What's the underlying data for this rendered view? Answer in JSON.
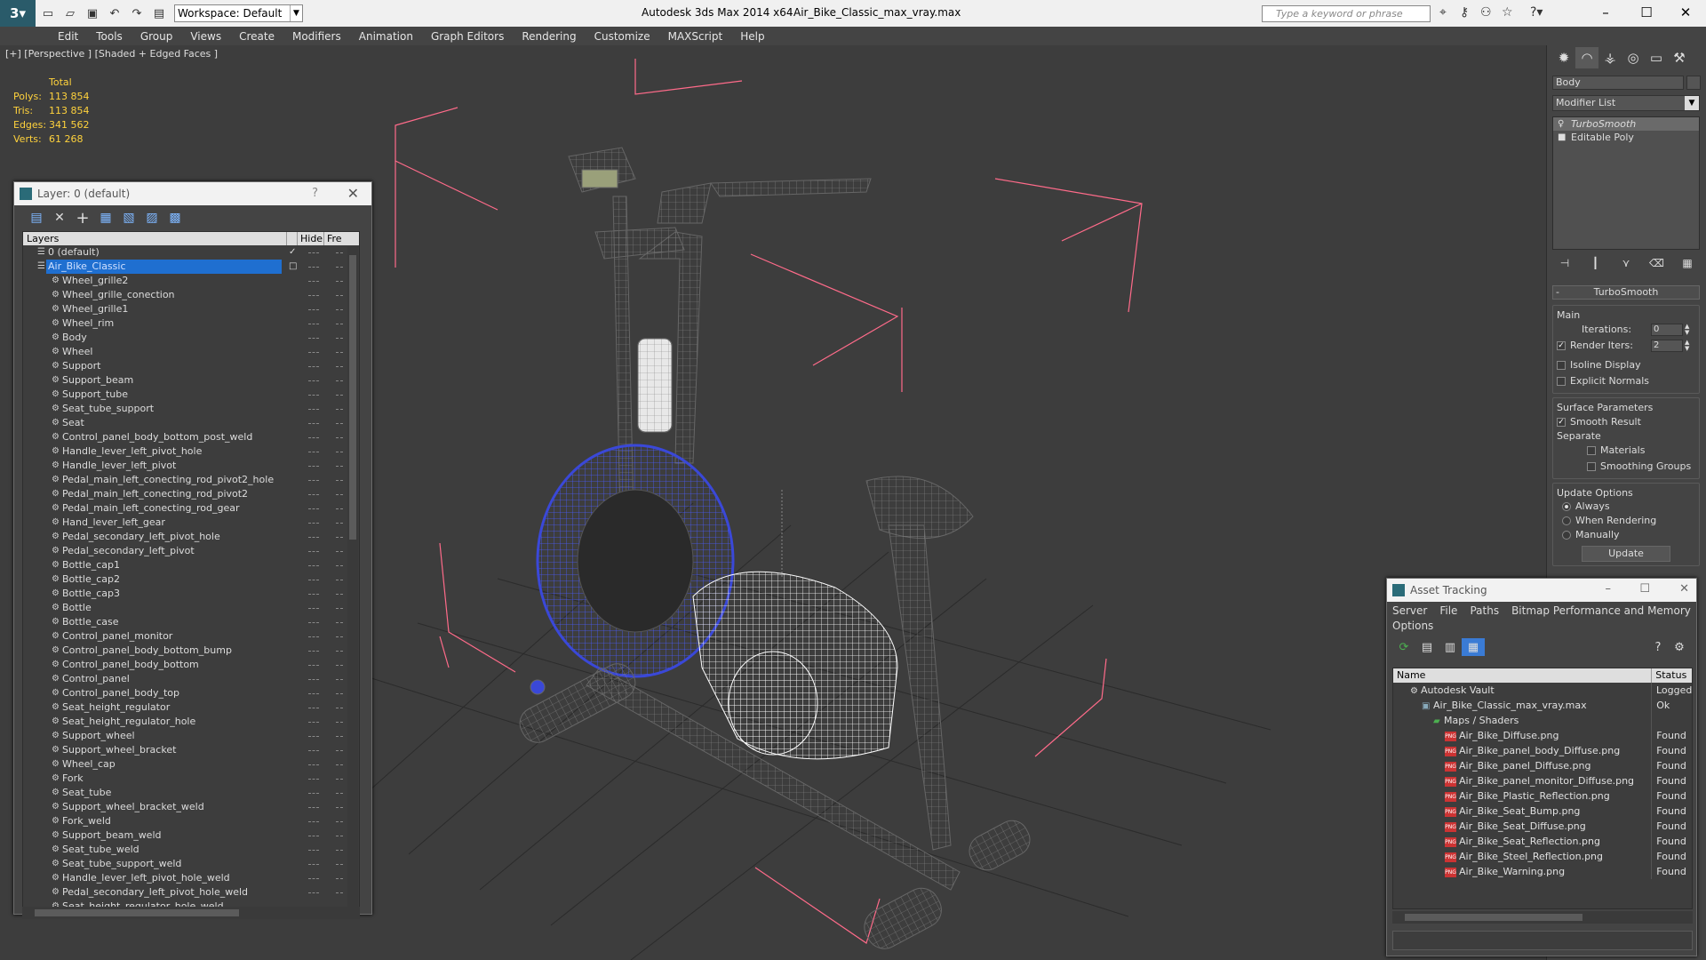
{
  "window": {
    "title": "Autodesk 3ds Max  2014 x64",
    "file": "Air_Bike_Classic_max_vray.max",
    "workspace": "Workspace: Default",
    "search_placeholder": "Type a keyword or phrase",
    "minimize": "–",
    "maximize": "☐",
    "close": "✕"
  },
  "menu": [
    "Edit",
    "Tools",
    "Group",
    "Views",
    "Create",
    "Modifiers",
    "Animation",
    "Graph Editors",
    "Rendering",
    "Customize",
    "MAXScript",
    "Help"
  ],
  "viewport": {
    "label": "[+] [Perspective ] [Shaded + Edged Faces ]",
    "stats": {
      "header": "Total",
      "rows": [
        {
          "label": "Polys:",
          "value": "113 854"
        },
        {
          "label": "Tris:",
          "value": "113 854"
        },
        {
          "label": "Edges:",
          "value": "341 562"
        },
        {
          "label": "Verts:",
          "value": "61 268"
        }
      ]
    }
  },
  "layer_window": {
    "title": "Layer: 0 (default)",
    "help": "?",
    "close": "✕",
    "columns": {
      "layers": "Layers",
      "hide": "Hide",
      "freeze": "Fre"
    },
    "layers": [
      {
        "name": "0 (default)",
        "level": 0,
        "check": "✓"
      },
      {
        "name": "Air_Bike_Classic",
        "level": 0,
        "selected": true,
        "check": "□"
      }
    ],
    "objects": [
      "Wheel_grille2",
      "Wheel_grille_conection",
      "Wheel_grille1",
      "Wheel_rim",
      "Body",
      "Wheel",
      "Support",
      "Support_beam",
      "Support_tube",
      "Seat_tube_support",
      "Seat",
      "Control_panel_body_bottom_post_weld",
      "Handle_lever_left_pivot_hole",
      "Handle_lever_left_pivot",
      "Pedal_main_left_conecting_rod_pivot2_hole",
      "Pedal_main_left_conecting_rod_pivot2",
      "Pedal_main_left_conecting_rod_gear",
      "Hand_lever_left_gear",
      "Pedal_secondary_left_pivot_hole",
      "Pedal_secondary_left_pivot",
      "Bottle_cap1",
      "Bottle_cap2",
      "Bottle_cap3",
      "Bottle",
      "Bottle_case",
      "Control_panel_monitor",
      "Control_panel_body_bottom_bump",
      "Control_panel_body_bottom",
      "Control_panel",
      "Control_panel_body_top",
      "Seat_height_regulator",
      "Seat_height_regulator_hole",
      "Support_wheel",
      "Support_wheel_bracket",
      "Wheel_cap",
      "Fork",
      "Seat_tube",
      "Support_wheel_bracket_weld",
      "Fork_weld",
      "Support_beam_weld",
      "Seat_tube_weld",
      "Seat_tube_support_weld",
      "Handle_lever_left_pivot_hole_weld",
      "Pedal_secondary_left_pivot_hole_weld",
      "Seat_height_regulator_hole_weld"
    ]
  },
  "command_panel": {
    "object_name": "Body",
    "modifier_list": "Modifier List",
    "stack": [
      {
        "name": "TurboSmooth",
        "selected": true
      },
      {
        "name": "Editable Poly",
        "selected": false
      }
    ],
    "turbosmooth": {
      "rollout": "TurboSmooth",
      "main_label": "Main",
      "iterations_label": "Iterations:",
      "iterations_value": "0",
      "render_iters_label": "Render Iters:",
      "render_iters_value": "2",
      "isoline_display": "Isoline Display",
      "explicit_normals": "Explicit Normals",
      "surface_params": "Surface Parameters",
      "smooth_result": "Smooth Result",
      "separate": "Separate",
      "materials": "Materials",
      "smoothing_groups": "Smoothing Groups",
      "update_options": "Update Options",
      "always": "Always",
      "when_rendering": "When Rendering",
      "manually": "Manually",
      "update_button": "Update"
    }
  },
  "asset_window": {
    "title": "Asset Tracking",
    "menu": [
      "Server",
      "File",
      "Paths",
      "Bitmap Performance and Memory"
    ],
    "menu2": "Options",
    "columns": {
      "name": "Name",
      "status": "Status"
    },
    "rows": [
      {
        "name": "Autodesk Vault",
        "status": "Logged",
        "type": "vault",
        "indent": 1
      },
      {
        "name": "Air_Bike_Classic_max_vray.max",
        "status": "Ok",
        "type": "file",
        "indent": 2
      },
      {
        "name": "Maps / Shaders",
        "status": "",
        "type": "folder",
        "indent": 3
      },
      {
        "name": "Air_Bike_Diffuse.png",
        "status": "Found",
        "type": "png",
        "indent": 4
      },
      {
        "name": "Air_Bike_panel_body_Diffuse.png",
        "status": "Found",
        "type": "png",
        "indent": 4
      },
      {
        "name": "Air_Bike_panel_Diffuse.png",
        "status": "Found",
        "type": "png",
        "indent": 4
      },
      {
        "name": "Air_Bike_panel_monitor_Diffuse.png",
        "status": "Found",
        "type": "png",
        "indent": 4
      },
      {
        "name": "Air_Bike_Plastic_Reflection.png",
        "status": "Found",
        "type": "png",
        "indent": 4
      },
      {
        "name": "Air_Bike_Seat_Bump.png",
        "status": "Found",
        "type": "png",
        "indent": 4
      },
      {
        "name": "Air_Bike_Seat_Diffuse.png",
        "status": "Found",
        "type": "png",
        "indent": 4
      },
      {
        "name": "Air_Bike_Seat_Reflection.png",
        "status": "Found",
        "type": "png",
        "indent": 4
      },
      {
        "name": "Air_Bike_Steel_Reflection.png",
        "status": "Found",
        "type": "png",
        "indent": 4
      },
      {
        "name": "Air_Bike_Warning.png",
        "status": "Found",
        "type": "png",
        "indent": 4
      }
    ]
  },
  "colors": {
    "accent": "#1f6fd0",
    "stats": "#ffd23c",
    "bbox": "#ff6b8a",
    "fan": "#3a48d8"
  }
}
